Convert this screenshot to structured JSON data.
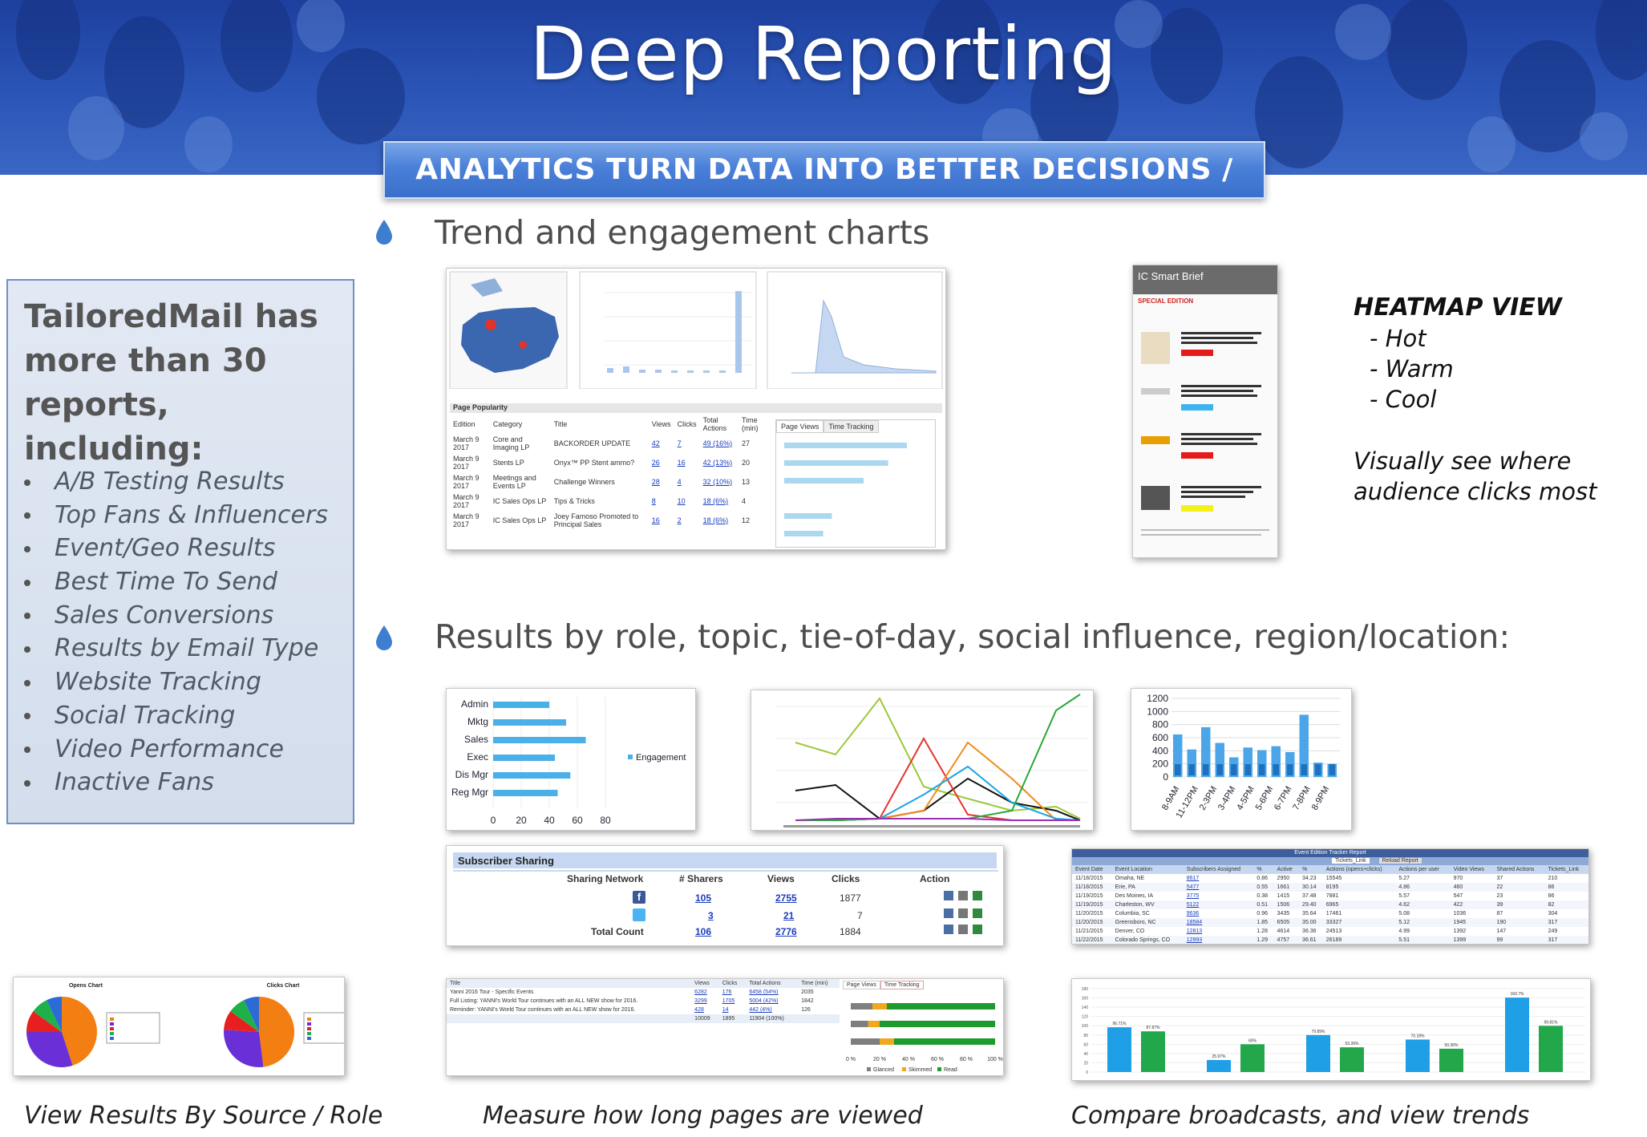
{
  "title": "Deep Reporting",
  "subtitle": "ANALYTICS TURN DATA INTO BETTER DECISIONS / TARGETING",
  "headings": {
    "trend": "Trend and engagement charts",
    "results": "Results by role, topic, tie-of-day, social influence, region/location:"
  },
  "left_box": {
    "title": "TailoredMail has more than 30 reports, including:",
    "items": [
      "A/B Testing Results",
      "Top Fans & Influencers",
      "Event/Geo Results",
      "Best Time To Send",
      "Sales Conversions",
      "Results by Email Type",
      "Website Tracking",
      "Social Tracking",
      "Video Performance",
      "Inactive Fans"
    ]
  },
  "heatmap": {
    "title": "HEATMAP VIEW",
    "levels": [
      "- Hot",
      "- Warm",
      "- Cool"
    ],
    "description": "Visually see where audience clicks most",
    "brand": "IC Smart Brief",
    "edition": "SPECIAL EDITION"
  },
  "captions": {
    "source_role": "View Results By Source / Role",
    "pages_viewed": "Measure how long pages are viewed",
    "broadcasts": "Compare broadcasts, and view trends"
  },
  "page_popularity": {
    "title": "Page Popularity",
    "columns": [
      "Edition",
      "Category",
      "Title",
      "Views",
      "Clicks",
      "Total Actions",
      "Time (min)"
    ],
    "rows": [
      [
        "March 9 2017",
        "Core and Imaging LP",
        "BACKORDER UPDATE",
        "42",
        "7",
        "49 (16%)",
        "27"
      ],
      [
        "March 9 2017",
        "Stents LP",
        "Onyx™ PP Stent ammo?",
        "26",
        "16",
        "42 (13%)",
        "20"
      ],
      [
        "March 9 2017",
        "Meetings and Events LP",
        "Challenge Winners",
        "28",
        "4",
        "32 (10%)",
        "13"
      ],
      [
        "March 9 2017",
        "IC Sales Ops LP",
        "Tips & Tricks",
        "8",
        "10",
        "18 (6%)",
        "4"
      ],
      [
        "March 9 2017",
        "IC Sales Ops LP",
        "Joey Famoso Promoted to Principal Sales",
        "16",
        "2",
        "18 (6%)",
        "12"
      ]
    ],
    "tabs": [
      "Page Views",
      "Time Tracking"
    ],
    "bar_fractions": [
      0.85,
      0.72,
      0.55,
      0.0,
      0.33,
      0.27
    ]
  },
  "role_chart": {
    "type": "bar",
    "categories": [
      "Admin",
      "Mktg",
      "Sales",
      "Exec",
      "Dis Mgr",
      "Reg Mgr"
    ],
    "values": [
      40,
      52,
      66,
      44,
      55,
      46
    ],
    "xticks": [
      "0",
      "20",
      "40",
      "60",
      "80"
    ],
    "xlim": [
      0,
      80
    ],
    "legend": "Engagement"
  },
  "time_chart": {
    "type": "bar",
    "categories": [
      "8-9AM",
      "11-12PM",
      "2-3PM",
      "3-4PM",
      "4-5PM",
      "5-6PM",
      "6-7PM",
      "7-8PM",
      "8-9PM"
    ],
    "values": [
      650,
      420,
      760,
      520,
      300,
      450,
      410,
      470,
      380,
      950,
      220,
      200
    ],
    "yticks": [
      "1200",
      "1000",
      "800",
      "600",
      "400",
      "200",
      "0"
    ],
    "ylim": [
      0,
      1200
    ]
  },
  "subscriber_sharing": {
    "title": "Subscriber Sharing",
    "columns": [
      "Sharing Network",
      "# Sharers",
      "Views",
      "Clicks",
      "Action"
    ],
    "rows": [
      {
        "network": "facebook",
        "sharers": "105",
        "views": "2755",
        "clicks": "1877"
      },
      {
        "network": "twitter",
        "sharers": "3",
        "views": "21",
        "clicks": "7"
      }
    ],
    "total_label": "Total Count",
    "total": {
      "sharers": "106",
      "views": "2776",
      "clicks": "1884"
    }
  },
  "event_tracker": {
    "title": "Event Edition Tracker Report",
    "button": "Reload Report",
    "select": "Tickets_Link",
    "columns": [
      "Event Date",
      "Event Location",
      "Subscribers Assigned",
      "%",
      "Active",
      "%",
      "Actions (opens+clicks)",
      "Actions per user",
      "Video Views",
      "Shared Actions",
      "Tickets_Link"
    ],
    "rows": [
      [
        "11/18/2015",
        "Omaha, NE",
        "8617",
        "0.86",
        "2950",
        "34.23",
        "15545",
        "5.27",
        "970",
        "37",
        "210"
      ],
      [
        "11/18/2015",
        "Erie, PA",
        "5477",
        "0.55",
        "1661",
        "30.14",
        "8195",
        "4.86",
        "460",
        "22",
        "86"
      ],
      [
        "11/19/2015",
        "Des Moines, IA",
        "3775",
        "0.38",
        "1415",
        "37.48",
        "7881",
        "5.57",
        "547",
        "23",
        "86"
      ],
      [
        "11/19/2015",
        "Charleston, WV",
        "5122",
        "0.51",
        "1506",
        "29.40",
        "6965",
        "4.62",
        "422",
        "39",
        "82"
      ],
      [
        "11/20/2015",
        "Columbia, SC",
        "9636",
        "0.96",
        "3435",
        "35.64",
        "17461",
        "5.08",
        "1036",
        "87",
        "304"
      ],
      [
        "11/20/2015",
        "Greensboro, NC",
        "18584",
        "1.85",
        "6505",
        "35.00",
        "33327",
        "5.12",
        "1945",
        "190",
        "317"
      ],
      [
        "11/21/2015",
        "Denver, CO",
        "12813",
        "1.28",
        "4614",
        "36.36",
        "24513",
        "4.99",
        "1392",
        "147",
        "249"
      ],
      [
        "11/22/2015",
        "Colorado Springs, CO",
        "12993",
        "1.29",
        "4757",
        "36.61",
        "26189",
        "5.51",
        "1399",
        "99",
        "317"
      ]
    ]
  },
  "time_tracking": {
    "columns": [
      "Title",
      "Views",
      "Clicks",
      "Total Actions",
      "Time (min)"
    ],
    "rows": [
      [
        "Yanni 2016 Tour - Specific Events",
        "6282",
        "176",
        "6458 (54%)",
        "2035"
      ],
      [
        "Full Listing: YANNI's World Tour continues with an ALL NEW show for 2016.",
        "3299",
        "1705",
        "5004 (42%)",
        "1842"
      ],
      [
        "Reminder: YANNI's World Tour continues with an ALL NEW show for 2016.",
        "428",
        "14",
        "442 (4%)",
        "126"
      ]
    ],
    "total": [
      "",
      "10009",
      "1895",
      "11904 (100%)",
      ""
    ],
    "tabs": [
      "Page Views",
      "Time Tracking"
    ],
    "legend": [
      "Glanced",
      "Skimmed",
      "Read"
    ],
    "xticks": [
      "0 %",
      "20 %",
      "40 %",
      "60 %",
      "80 %",
      "100 %"
    ],
    "bars": [
      [
        0.15,
        0.1,
        0.75
      ],
      [
        0.12,
        0.08,
        0.8
      ],
      [
        0.2,
        0.1,
        0.7
      ]
    ]
  },
  "compare_chart": {
    "labels": [
      "96.71%",
      "87.87%",
      "25.97%",
      "60%",
      "79.89%",
      "53.39%",
      "70.18%",
      "50.36%",
      "160.7%",
      "99.81%"
    ],
    "values": [
      96.71,
      87.87,
      25.97,
      60,
      79.89,
      53.39,
      70.18,
      50.36,
      160.7,
      99.81
    ],
    "ylim": [
      0,
      180
    ],
    "yticks": [
      "0",
      "20",
      "40",
      "60",
      "80",
      "100",
      "120",
      "140",
      "160",
      "180"
    ]
  },
  "pie_charts": [
    {
      "title": "Opens Chart",
      "slices": [
        45,
        30,
        10,
        8,
        7
      ]
    },
    {
      "title": "Clicks Chart",
      "slices": [
        48,
        28,
        9,
        8,
        7
      ]
    }
  ],
  "colors": {
    "banner": "#2b56b8",
    "accent": "#3b6fcc",
    "bar_blue": "#1e9fe6",
    "bar_green": "#22a84a"
  }
}
